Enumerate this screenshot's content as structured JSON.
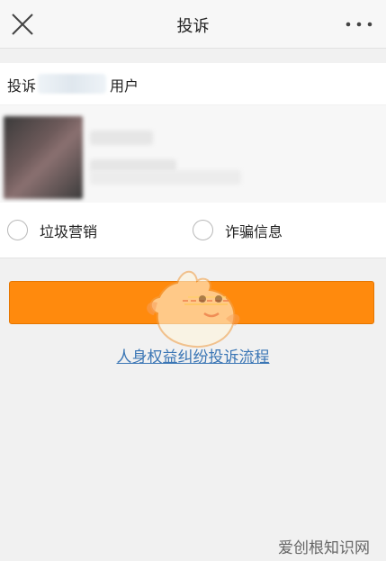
{
  "header": {
    "title": "投诉",
    "close_icon": "close-icon",
    "more_icon": "more-dots-icon"
  },
  "target": {
    "prefix": "投诉",
    "suffix": "用户"
  },
  "options": [
    {
      "label": "垃圾营销"
    },
    {
      "label": "诈骗信息"
    }
  ],
  "link": {
    "text": "人身权益纠纷投诉流程"
  },
  "watermark": {
    "text": "爱创根知识网"
  },
  "colors": {
    "accent": "#ff8a0d",
    "link": "#3b76b5"
  }
}
